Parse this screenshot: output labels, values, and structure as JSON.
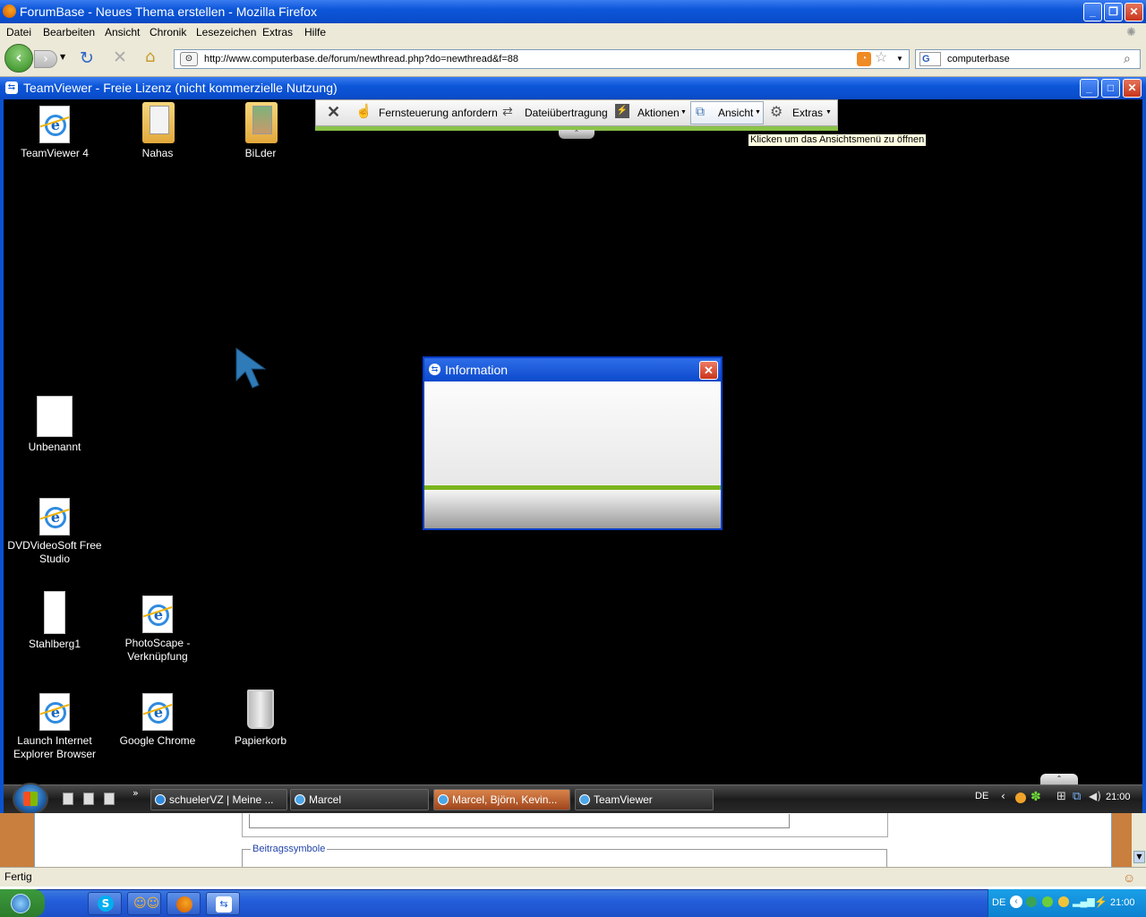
{
  "firefox": {
    "window_title": "ForumBase - Neues Thema erstellen - Mozilla Firefox",
    "menu": [
      "Datei",
      "Bearbeiten",
      "Ansicht",
      "Chronik",
      "Lesezeichen",
      "Extras",
      "Hilfe"
    ],
    "url": "http://www.computerbase.de/forum/newthread.php?do=newthread&f=88",
    "search_engine_letter": "G",
    "search_value": "computerbase",
    "page_legend": "Beitragssymbole",
    "status": "Fertig"
  },
  "teamviewer": {
    "window_title": "TeamViewer - Freie Lizenz (nicht kommerzielle Nutzung)",
    "toolbar": {
      "remote_control": "Fernsteuerung anfordern",
      "file_transfer": "Dateiübertragung",
      "actions": "Aktionen",
      "view": "Ansicht",
      "extras": "Extras"
    },
    "tooltip": "Klicken um das Ansichtsmenü zu öffnen",
    "dialog_title": "Information"
  },
  "desktop_icons": {
    "teamviewer4": "TeamViewer 4",
    "nahas": "Nahas",
    "bilder": "BiLder",
    "unbenannt": "Unbenannt",
    "dvdvideosoft": "DVDVideoSoft Free Studio",
    "stahlberg1": "Stahlberg1",
    "photoscape": "PhotoScape - Verknüpfung",
    "launch_ie": "Launch Internet Explorer Browser",
    "google_chrome": "Google Chrome",
    "papierkorb": "Papierkorb"
  },
  "remote_taskbar": {
    "tasks": [
      "schuelerVZ | Meine ...",
      "Marcel",
      "Marcel, Björn, Kevin...",
      "TeamViewer"
    ],
    "language": "DE",
    "clock": "21:00"
  },
  "local_taskbar": {
    "language": "DE",
    "clock": "21:00"
  },
  "colors": {
    "xp_blue": "#0c56d9",
    "tv_green": "#8bc34a",
    "desktop_black": "#000000"
  }
}
